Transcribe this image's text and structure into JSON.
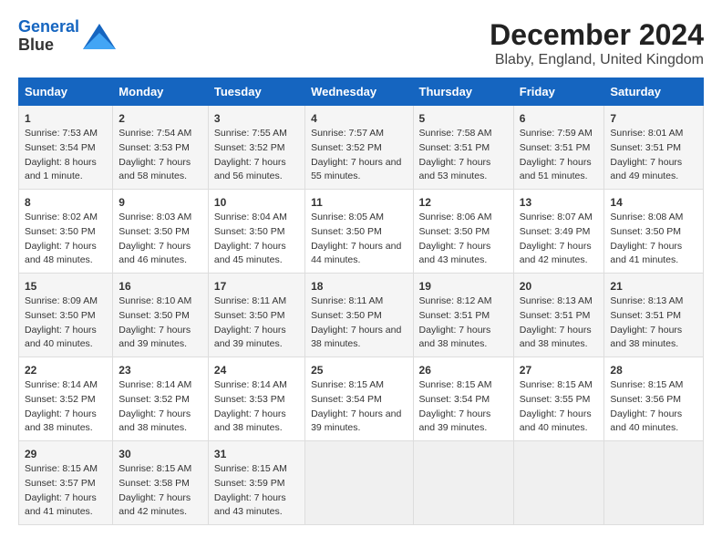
{
  "logo": {
    "line1": "General",
    "line2": "Blue"
  },
  "title": "December 2024",
  "subtitle": "Blaby, England, United Kingdom",
  "days_of_week": [
    "Sunday",
    "Monday",
    "Tuesday",
    "Wednesday",
    "Thursday",
    "Friday",
    "Saturday"
  ],
  "weeks": [
    [
      {
        "day": "1",
        "sunrise": "7:53 AM",
        "sunset": "3:54 PM",
        "daylight": "8 hours and 1 minute."
      },
      {
        "day": "2",
        "sunrise": "7:54 AM",
        "sunset": "3:53 PM",
        "daylight": "7 hours and 58 minutes."
      },
      {
        "day": "3",
        "sunrise": "7:55 AM",
        "sunset": "3:52 PM",
        "daylight": "7 hours and 56 minutes."
      },
      {
        "day": "4",
        "sunrise": "7:57 AM",
        "sunset": "3:52 PM",
        "daylight": "7 hours and 55 minutes."
      },
      {
        "day": "5",
        "sunrise": "7:58 AM",
        "sunset": "3:51 PM",
        "daylight": "7 hours and 53 minutes."
      },
      {
        "day": "6",
        "sunrise": "7:59 AM",
        "sunset": "3:51 PM",
        "daylight": "7 hours and 51 minutes."
      },
      {
        "day": "7",
        "sunrise": "8:01 AM",
        "sunset": "3:51 PM",
        "daylight": "7 hours and 49 minutes."
      }
    ],
    [
      {
        "day": "8",
        "sunrise": "8:02 AM",
        "sunset": "3:50 PM",
        "daylight": "7 hours and 48 minutes."
      },
      {
        "day": "9",
        "sunrise": "8:03 AM",
        "sunset": "3:50 PM",
        "daylight": "7 hours and 46 minutes."
      },
      {
        "day": "10",
        "sunrise": "8:04 AM",
        "sunset": "3:50 PM",
        "daylight": "7 hours and 45 minutes."
      },
      {
        "day": "11",
        "sunrise": "8:05 AM",
        "sunset": "3:50 PM",
        "daylight": "7 hours and 44 minutes."
      },
      {
        "day": "12",
        "sunrise": "8:06 AM",
        "sunset": "3:50 PM",
        "daylight": "7 hours and 43 minutes."
      },
      {
        "day": "13",
        "sunrise": "8:07 AM",
        "sunset": "3:49 PM",
        "daylight": "7 hours and 42 minutes."
      },
      {
        "day": "14",
        "sunrise": "8:08 AM",
        "sunset": "3:50 PM",
        "daylight": "7 hours and 41 minutes."
      }
    ],
    [
      {
        "day": "15",
        "sunrise": "8:09 AM",
        "sunset": "3:50 PM",
        "daylight": "7 hours and 40 minutes."
      },
      {
        "day": "16",
        "sunrise": "8:10 AM",
        "sunset": "3:50 PM",
        "daylight": "7 hours and 39 minutes."
      },
      {
        "day": "17",
        "sunrise": "8:11 AM",
        "sunset": "3:50 PM",
        "daylight": "7 hours and 39 minutes."
      },
      {
        "day": "18",
        "sunrise": "8:11 AM",
        "sunset": "3:50 PM",
        "daylight": "7 hours and 38 minutes."
      },
      {
        "day": "19",
        "sunrise": "8:12 AM",
        "sunset": "3:51 PM",
        "daylight": "7 hours and 38 minutes."
      },
      {
        "day": "20",
        "sunrise": "8:13 AM",
        "sunset": "3:51 PM",
        "daylight": "7 hours and 38 minutes."
      },
      {
        "day": "21",
        "sunrise": "8:13 AM",
        "sunset": "3:51 PM",
        "daylight": "7 hours and 38 minutes."
      }
    ],
    [
      {
        "day": "22",
        "sunrise": "8:14 AM",
        "sunset": "3:52 PM",
        "daylight": "7 hours and 38 minutes."
      },
      {
        "day": "23",
        "sunrise": "8:14 AM",
        "sunset": "3:52 PM",
        "daylight": "7 hours and 38 minutes."
      },
      {
        "day": "24",
        "sunrise": "8:14 AM",
        "sunset": "3:53 PM",
        "daylight": "7 hours and 38 minutes."
      },
      {
        "day": "25",
        "sunrise": "8:15 AM",
        "sunset": "3:54 PM",
        "daylight": "7 hours and 39 minutes."
      },
      {
        "day": "26",
        "sunrise": "8:15 AM",
        "sunset": "3:54 PM",
        "daylight": "7 hours and 39 minutes."
      },
      {
        "day": "27",
        "sunrise": "8:15 AM",
        "sunset": "3:55 PM",
        "daylight": "7 hours and 40 minutes."
      },
      {
        "day": "28",
        "sunrise": "8:15 AM",
        "sunset": "3:56 PM",
        "daylight": "7 hours and 40 minutes."
      }
    ],
    [
      {
        "day": "29",
        "sunrise": "8:15 AM",
        "sunset": "3:57 PM",
        "daylight": "7 hours and 41 minutes."
      },
      {
        "day": "30",
        "sunrise": "8:15 AM",
        "sunset": "3:58 PM",
        "daylight": "7 hours and 42 minutes."
      },
      {
        "day": "31",
        "sunrise": "8:15 AM",
        "sunset": "3:59 PM",
        "daylight": "7 hours and 43 minutes."
      },
      null,
      null,
      null,
      null
    ]
  ]
}
